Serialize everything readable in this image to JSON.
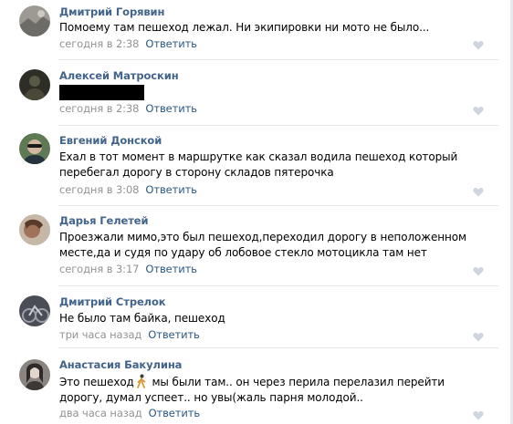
{
  "comments": [
    {
      "author": "Дмитрий Горявин",
      "text": "Помоему там пешеход лежал. Ни экипировки ни мото не было...",
      "time": "сегодня в 2:38",
      "reply_label": "Ответить",
      "avatar_icon": "user-avatar-photo",
      "avatar_color": "#8a8a82"
    },
    {
      "author": "Алексей Матроскин",
      "text": "",
      "redacted": true,
      "time": "сегодня в 2:38",
      "reply_label": "Ответить",
      "avatar_icon": "user-avatar-photo",
      "avatar_color": "#3b3a2e"
    },
    {
      "author": "Евгений Донской",
      "text": "Ехал в тот момент в маршрутке как сказал водила пешеход который перебегал дорогу в сторону складов пятерочка",
      "time": "сегодня в 3:08",
      "reply_label": "Ответить",
      "avatar_icon": "user-avatar-photo",
      "avatar_color": "#3f5a3a"
    },
    {
      "author": "Дарья Гелетей",
      "text": "Проезжали мимо,это был пешеход,переходил дорогу в неположенном месте,да и судя по удару об лобовое стекло мотоцикла там нет",
      "time": "сегодня в 3:17",
      "reply_label": "Ответить",
      "avatar_icon": "user-avatar-photo",
      "avatar_color": "#b08a6e"
    },
    {
      "author": "Дмитрий Стрелок",
      "text": "Не было там байка, пешеход",
      "time": "три часа назад",
      "reply_label": "Ответить",
      "avatar_icon": "user-avatar-photo",
      "avatar_color": "#5b5e66"
    },
    {
      "author": "Анастасия Бакулина",
      "text_before_emoji": "Это пешеход",
      "emoji_icon": "walking-person-emoji",
      "text_after_emoji": " мы были там.. он через перила перелазил перейти дорогу, думал успеет.. но увы(жаль парня молодой..",
      "time": "два часа назад",
      "reply_label": "Ответить",
      "avatar_icon": "user-avatar-photo",
      "avatar_color": "#6f6a66"
    }
  ],
  "colors": {
    "author": "#42648b",
    "reply": "#2a5885",
    "meta": "#939393",
    "like": "#cfd6df",
    "divider": "#e7e8ec"
  }
}
